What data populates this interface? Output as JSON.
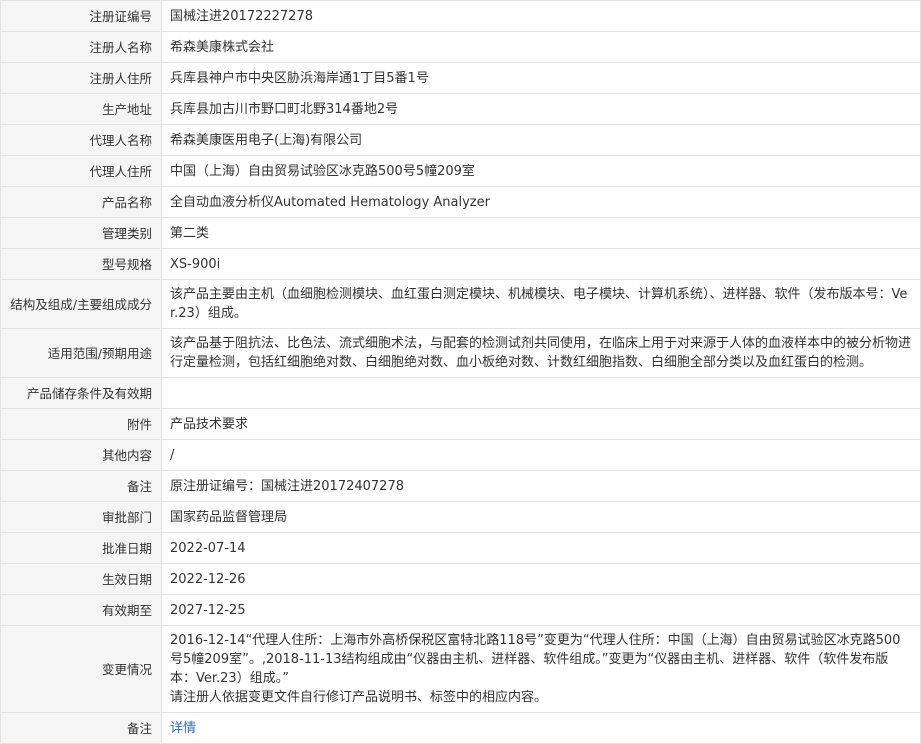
{
  "rows": [
    {
      "label": "注册证编号",
      "value": "国械注进20172227278"
    },
    {
      "label": "注册人名称",
      "value": "希森美康株式会社"
    },
    {
      "label": "注册人住所",
      "value": "兵库县神户市中央区胁浜海岸通1丁目5番1号"
    },
    {
      "label": "生产地址",
      "value": "兵库县加古川市野口町北野314番地2号"
    },
    {
      "label": "代理人名称",
      "value": "希森美康医用电子(上海)有限公司"
    },
    {
      "label": "代理人住所",
      "value": "中国（上海）自由贸易试验区冰克路500号5幢209室"
    },
    {
      "label": "产品名称",
      "value": "全自动血液分析仪Automated Hematology Analyzer"
    },
    {
      "label": "管理类别",
      "value": "第二类"
    },
    {
      "label": "型号规格",
      "value": "XS-900i"
    },
    {
      "label": "结构及组成/主要组成成分",
      "value": "该产品主要由主机（血细胞检测模块、血红蛋白测定模块、机械模块、电子模块、计算机系统）、进样器、软件（发布版本号：Ver.23）组成。"
    },
    {
      "label": "适用范围/预期用途",
      "value": "该产品基于阻抗法、比色法、流式细胞术法，与配套的检测试剂共同使用，在临床上用于对来源于人体的血液样本中的被分析物进行定量检测，包括红细胞绝对数、白细胞绝对数、血小板绝对数、计数红细胞指数、白细胞全部分类以及血红蛋白的检测。"
    },
    {
      "label": "产品储存条件及有效期",
      "value": ""
    },
    {
      "label": "附件",
      "value": "产品技术要求"
    },
    {
      "label": "其他内容",
      "value": "/"
    },
    {
      "label": "备注",
      "value": "原注册证编号：国械注进20172407278"
    },
    {
      "label": "审批部门",
      "value": "国家药品监督管理局"
    },
    {
      "label": "批准日期",
      "value": "2022-07-14"
    },
    {
      "label": "生效日期",
      "value": "2022-12-26"
    },
    {
      "label": "有效期至",
      "value": "2027-12-25"
    }
  ],
  "change": {
    "label": "变更情况",
    "line1": "2016-12-14“代理人住所：上海市外高桥保税区富特北路118号”变更为“代理人住所：中国（上海）自由贸易试验区冰克路500号5幢209室”。,2018-11-13结构组成由“仪器由主机、进样器、软件组成。”变更为“仪器由主机、进样器、软件（软件发布版本：Ver.23）组成。”",
    "line2": "请注册人依据变更文件自行修订产品说明书、标签中的相应内容。"
  },
  "notes": {
    "label": "备注",
    "link_text": "详情"
  }
}
